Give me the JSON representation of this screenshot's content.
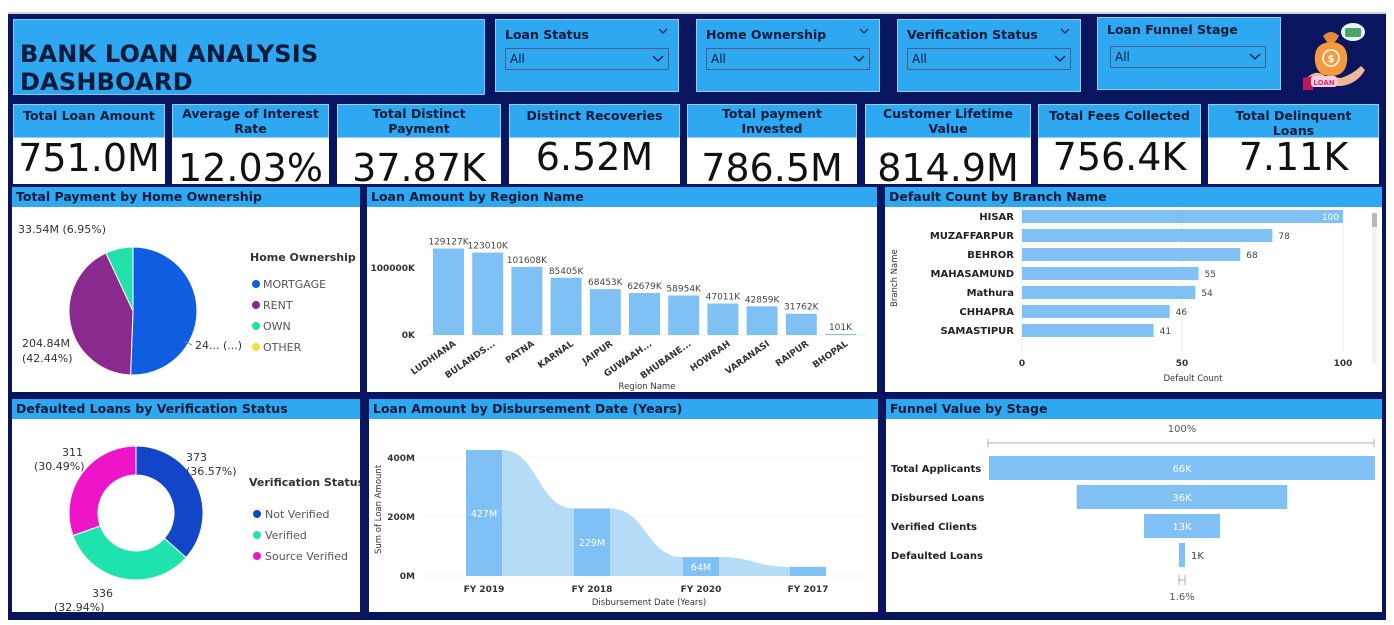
{
  "title": "BANK LOAN ANALYSIS DASHBOARD",
  "slicers": [
    {
      "label": "Loan Status",
      "value": "All"
    },
    {
      "label": "Home Ownership",
      "value": "All"
    },
    {
      "label": "Verification Status",
      "value": "All"
    },
    {
      "label": "Loan Funnel Stage",
      "value": "All"
    }
  ],
  "logo_text": "LOAN",
  "kpis": [
    {
      "label": "Total Loan Amount",
      "value": "751.0M"
    },
    {
      "label": "Average of Interest Rate",
      "value": "12.03%"
    },
    {
      "label": "Total Distinct Payment",
      "value": "37.87K"
    },
    {
      "label": "Distinct Recoveries",
      "value": "6.52M"
    },
    {
      "label": "Total payment Invested",
      "value": "786.5M"
    },
    {
      "label": "Customer Lifetime Value",
      "value": "814.9M"
    },
    {
      "label": "Total Fees Collected",
      "value": "756.4K"
    },
    {
      "label": "Total Delinquent Loans",
      "value": "7.11K"
    }
  ],
  "panels": {
    "home_ownership": "Total Payment by Home Ownership",
    "region": "Loan Amount by Region Name",
    "branch": "Default Count by Branch Name",
    "verification": "Defaulted Loans by Verification Status",
    "disbursement": "Loan Amount by Disbursement Date (Years)",
    "funnel": "Funnel Value by Stage"
  },
  "colors": {
    "accent": "#2ea8f0",
    "bar": "#7fc1f5",
    "background": "#0a1560",
    "mortgage": "#0f5de0",
    "rent": "#8b2a8e",
    "own": "#22e0a8",
    "other": "#f0e040",
    "not_verified": "#1245c7",
    "verified": "#1fe3ae",
    "source_verified": "#ee14c8"
  },
  "chart_data": [
    {
      "type": "pie",
      "legend_title": "Home Ownership",
      "categories": [
        "MORTGAGE",
        "RENT",
        "OWN",
        "OTHER"
      ],
      "values": [
        50.6,
        42.44,
        6.95,
        0.01
      ],
      "slice_labels": [
        {
          "value": "24... (...)"
        },
        {
          "value": "204.84M",
          "pct": "(42.44%)"
        },
        {
          "value": "33.54M (6.95%)"
        }
      ]
    },
    {
      "type": "bar",
      "categories": [
        "LUDHIANA",
        "BULANDS...",
        "PATNA",
        "KARNAL",
        "JAIPUR",
        "GUWAAH...",
        "BHUBANE...",
        "HOWRAH",
        "VARANASI",
        "RAIPUR",
        "BHOPAL"
      ],
      "values": [
        129127,
        123010,
        101608,
        85405,
        68453,
        62679,
        58954,
        47011,
        42859,
        31762,
        101
      ],
      "data_labels": [
        "129127K",
        "123010K",
        "101608K",
        "85405K",
        "68453K",
        "62679K",
        "58954K",
        "47011K",
        "42859K",
        "31762K",
        "101K"
      ],
      "yticks": [
        "100000K",
        "0K"
      ],
      "xlabel": "Region Name"
    },
    {
      "type": "bar",
      "orientation": "horizontal",
      "categories": [
        "HISAR",
        "MUZAFFARPUR",
        "BEHROR",
        "MAHASAMUND",
        "Mathura",
        "CHHAPRA",
        "SAMASTIPUR"
      ],
      "values": [
        100,
        78,
        68,
        55,
        54,
        46,
        41
      ],
      "xticks": [
        "0",
        "50",
        "100"
      ],
      "xlim": [
        0,
        100
      ],
      "xlabel": "Default Count",
      "ylabel": "Branch Name"
    },
    {
      "type": "pie",
      "style": "donut",
      "legend_title": "Verification Status",
      "categories": [
        "Not Verified",
        "Verified",
        "Source Verified"
      ],
      "values": [
        373,
        336,
        311
      ],
      "slice_labels": [
        {
          "value": "373",
          "pct": "(36.57%)"
        },
        {
          "value": "336",
          "pct": "(32.94%)"
        },
        {
          "value": "311",
          "pct": "(30.49%)"
        }
      ]
    },
    {
      "type": "bar",
      "style": "ribbon",
      "categories": [
        "FY 2019",
        "FY 2018",
        "FY 2020",
        "FY 2017"
      ],
      "values": [
        427,
        229,
        64,
        31
      ],
      "data_labels": [
        "427M",
        "229M",
        "64M",
        ""
      ],
      "yticks": [
        "400M",
        "200M",
        "0M"
      ],
      "xlabel": "Disbursement Date (Years)",
      "ylabel": "Sum of Loan Amount"
    },
    {
      "type": "bar",
      "style": "funnel",
      "categories": [
        "Total Applicants",
        "Disbursed Loans",
        "Verified Clients",
        "Defaulted Loans"
      ],
      "values": [
        66,
        36,
        13,
        1
      ],
      "data_labels": [
        "66K",
        "36K",
        "13K",
        "1K"
      ],
      "top_label": "100%",
      "bottom_label": "1.6%"
    }
  ]
}
